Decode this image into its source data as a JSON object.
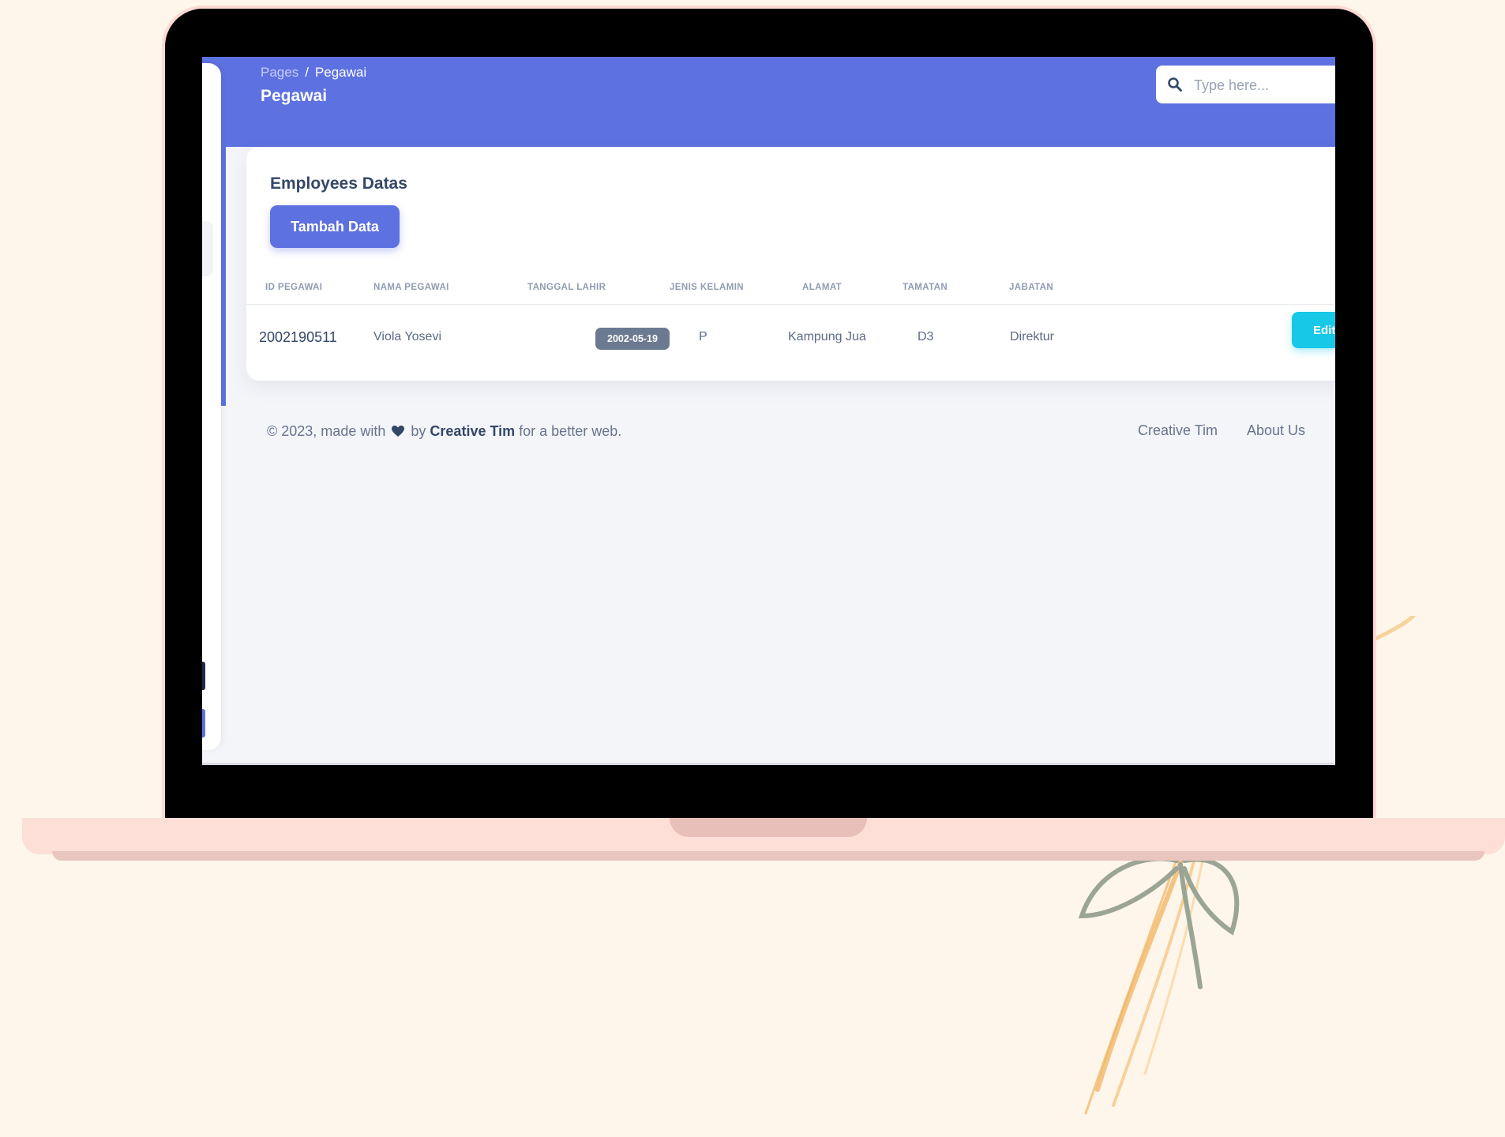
{
  "breadcrumb": {
    "root": "Pages",
    "separator": "/",
    "current": "Pegawai"
  },
  "page_title": "Pegawai",
  "search": {
    "placeholder": "Type here...",
    "icon": "search-icon"
  },
  "card": {
    "title": "Employees Datas",
    "add_button": "Tambah Data",
    "columns": [
      "ID PEGAWAI",
      "NAMA PEGAWAI",
      "TANGGAL LAHIR",
      "JENIS KELAMIN",
      "ALAMAT",
      "TAMATAN",
      "JABATAN"
    ],
    "rows": [
      {
        "id": "2002190511",
        "nama": "Viola Yosevi",
        "tanggal_lahir": "2002-05-19",
        "jenis_kelamin": "P",
        "alamat": "Kampung Jua",
        "tamatan": "D3",
        "jabatan": "Direktur",
        "action": "Edit"
      }
    ]
  },
  "footer": {
    "prefix": "© 2023, made with",
    "by": "by",
    "author": "Creative Tim",
    "suffix": "for a better web.",
    "links": [
      "Creative Tim",
      "About Us"
    ]
  },
  "colors": {
    "primary": "#5d71e0",
    "info": "#17c8e7",
    "badge": "#6b7a90",
    "background": "#fef6ea"
  }
}
